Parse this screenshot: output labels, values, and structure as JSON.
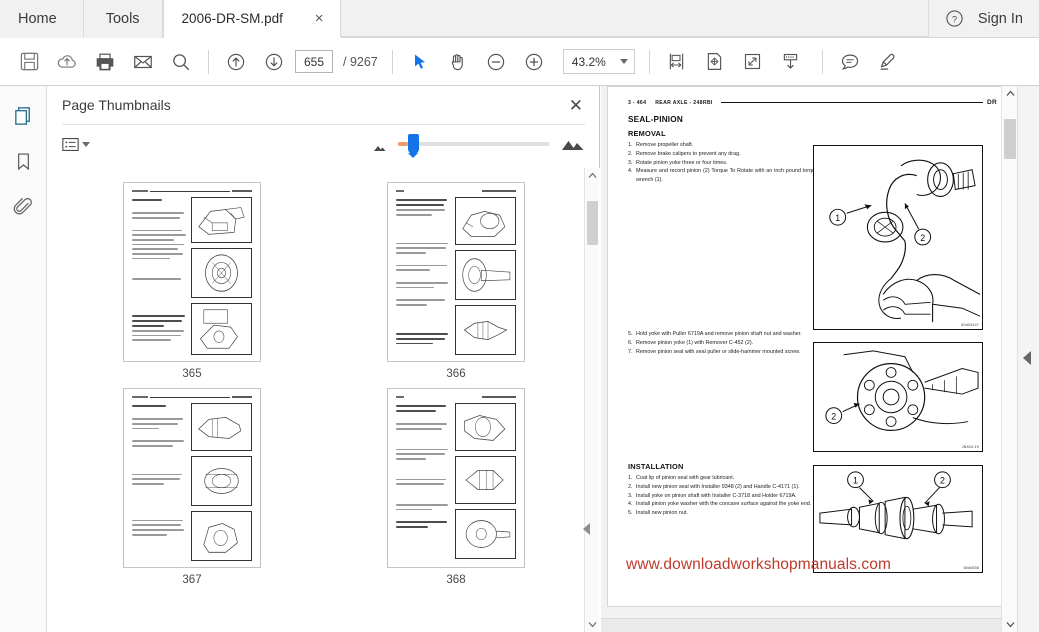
{
  "app": {
    "tabs": [
      {
        "label": "Home",
        "type": "nav"
      },
      {
        "label": "Tools",
        "type": "nav"
      },
      {
        "label": "2006-DR-SM.pdf",
        "type": "document",
        "close": "×"
      }
    ],
    "sign_in_label": "Sign In",
    "help_icon": "help-circle-icon"
  },
  "toolbar": {
    "icons": [
      {
        "name": "save-icon"
      },
      {
        "name": "upload-cloud-icon"
      },
      {
        "name": "print-icon"
      },
      {
        "name": "email-icon"
      },
      {
        "name": "search-icon"
      },
      {
        "name": "previous-page-icon"
      },
      {
        "name": "next-page-icon"
      }
    ],
    "page_current": "655",
    "page_total": "/ 9267",
    "right_icons": [
      {
        "name": "select-cursor-icon"
      },
      {
        "name": "pan-hand-icon"
      },
      {
        "name": "zoom-out-icon"
      },
      {
        "name": "zoom-in-icon"
      }
    ],
    "zoom_value": "43.2%",
    "view_icons": [
      {
        "name": "fit-width-icon"
      },
      {
        "name": "fit-page-icon"
      },
      {
        "name": "fullscreen-icon"
      },
      {
        "name": "download-icon"
      },
      {
        "name": "comment-icon"
      },
      {
        "name": "highlight-icon"
      }
    ]
  },
  "rail": {
    "items": [
      {
        "name": "page-thumbnails-icon",
        "active": true
      },
      {
        "name": "bookmarks-icon",
        "active": false
      },
      {
        "name": "attachments-icon",
        "active": false
      }
    ]
  },
  "thumbnail_panel": {
    "title": "Page Thumbnails",
    "close_label": "✕",
    "options_icon": "list-options-icon",
    "size_small_icon": "small-thumbnail-icon",
    "size_large_icon": "large-thumbnail-icon",
    "thumbnails": [
      {
        "page": "365"
      },
      {
        "page": "366"
      },
      {
        "page": "367"
      },
      {
        "page": "368"
      }
    ]
  },
  "document": {
    "header": {
      "page_number": "3 - 464",
      "title": "REAR AXLE - 248RBI",
      "right_tag": "DR"
    },
    "section_title": "SEAL-PINION",
    "removal": {
      "heading": "REMOVAL",
      "steps": [
        {
          "n": "1.",
          "text": "Remove propeller shaft."
        },
        {
          "n": "2.",
          "text": "Remove brake calipers to prevent any drag."
        },
        {
          "n": "3.",
          "text": "Rotate pinion yoke three or four times."
        },
        {
          "n": "4.",
          "text": "Measure and record pinion (2) Torque To Rotate with an inch pound torque wrench (1)."
        }
      ],
      "steps2": [
        {
          "n": "5.",
          "text": "Hold yoke with Puller 6719A and remove pinion shaft nut and washer."
        },
        {
          "n": "6.",
          "text": "Remove pinion yoke (1) with Remover C-452 (2)."
        },
        {
          "n": "7.",
          "text": "Remove pinion seal with seal puller or slide-hammer mounted screw."
        }
      ]
    },
    "installation": {
      "heading": "INSTALLATION",
      "steps": [
        {
          "n": "1.",
          "text": "Coat lip of pinion seal with gear lubricant."
        },
        {
          "n": "2.",
          "text": "Install new pinion seal with Installer 9348 (2) and Handle C-4171 (1)."
        },
        {
          "n": "3.",
          "text": "Install yoke on pinion shaft with Installer C-3718 and Holder 6719A."
        },
        {
          "n": "4.",
          "text": "Install pinion yoke washer with the concave surface against the yoke end."
        },
        {
          "n": "5.",
          "text": "Install new pinion nut."
        }
      ]
    },
    "figures": [
      {
        "name": "figure-torque-wrench",
        "tag": "80d03447",
        "callouts": [
          "1",
          "2"
        ]
      },
      {
        "name": "figure-pinion-yoke-remover",
        "tag": "JN403-19",
        "callouts": [
          "2"
        ]
      },
      {
        "name": "figure-seal-installer",
        "tag": "80d0558",
        "callouts": [
          "1",
          "2"
        ]
      }
    ],
    "watermark": "www.downloadworkshopmanuals.com"
  },
  "colors": {
    "accent": "#1473e6",
    "watermark": "#c0392b",
    "toolbar_bg": "#ffffff",
    "tabbar_bg": "#f1f1f1"
  }
}
